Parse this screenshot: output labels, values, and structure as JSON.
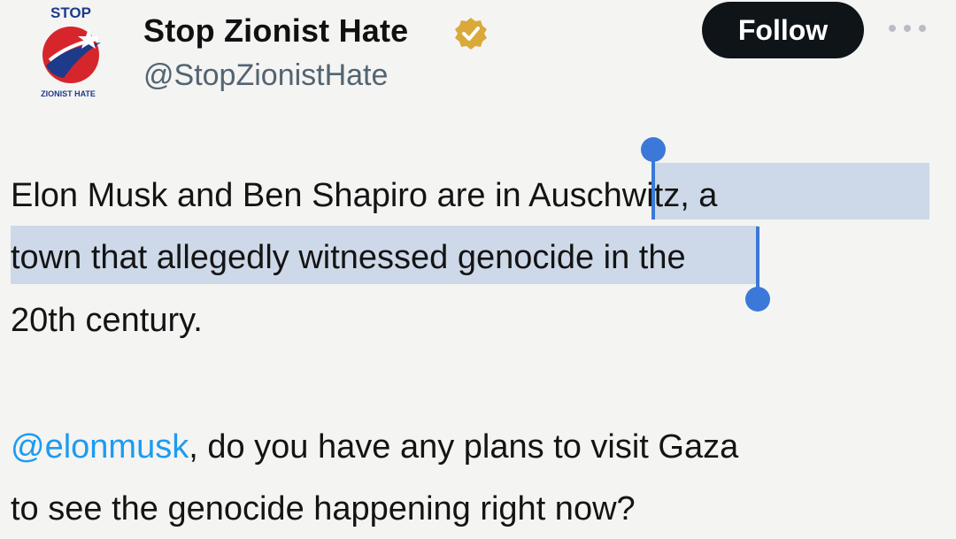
{
  "author": {
    "logo_top_text": "STOP",
    "logo_bottom_text": "ZIONIST HATE",
    "display_name": "Stop Zionist Hate",
    "handle": "@StopZionistHate",
    "verified_icon": "verified-badge-icon",
    "follow_label": "Follow",
    "more_icon": "more-options-icon"
  },
  "post": {
    "line1_before": "Elon Musk and Ben Shapiro are in ",
    "line1_selected": "Auschwitz, a",
    "line2_selected": "town that allegedly witnessed genocide",
    "line2_after": " in the",
    "line3": "20th century.",
    "mention": "@elonmusk",
    "line4_after": ", do you have any plans to visit Gaza",
    "line5": "to see the genocide happening right now?"
  },
  "colors": {
    "selection_highlight": "#cdd9e8",
    "selection_handle": "#3b78d8",
    "mention": "#1d9bf0",
    "follow_bg": "#0f1419",
    "logo_red": "#d7262b",
    "logo_blue": "#1e3a8a",
    "verified_gold": "#d9a93a"
  }
}
